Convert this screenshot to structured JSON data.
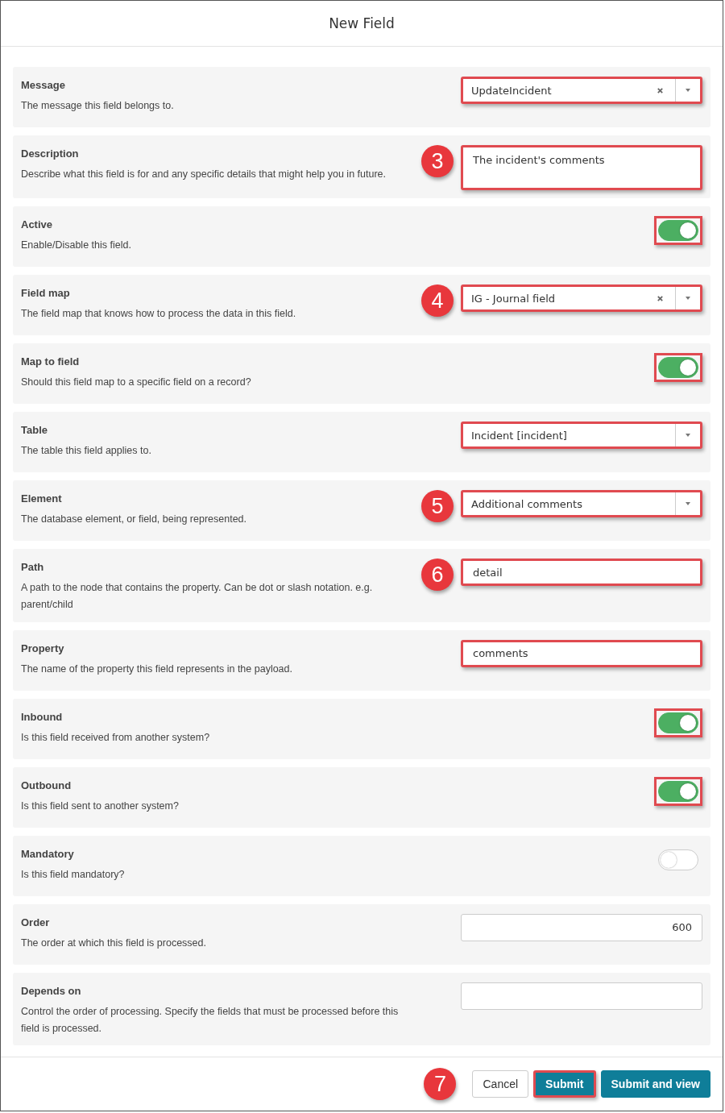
{
  "dialog": {
    "title": "New Field"
  },
  "rows": [
    {
      "label": "Message",
      "help": "The message this field belongs to.",
      "kind": "select",
      "value": "UpdateIncident",
      "clearable": true,
      "highlighted": true
    },
    {
      "label": "Description",
      "help": "Describe what this field is for and any specific details that might help you in future.",
      "kind": "textarea",
      "value": "The incident's comments",
      "highlighted": true,
      "callout": "3"
    },
    {
      "label": "Active",
      "help": "Enable/Disable this field.",
      "kind": "toggle",
      "on": true,
      "highlighted": true
    },
    {
      "label": "Field map",
      "help": "The field map that knows how to process the data in this field.",
      "kind": "select",
      "value": "IG - Journal field",
      "clearable": true,
      "highlighted": true,
      "callout": "4"
    },
    {
      "label": "Map to field",
      "help": "Should this field map to a specific field on a record?",
      "kind": "toggle",
      "on": true,
      "highlighted": true
    },
    {
      "label": "Table",
      "help": "The table this field applies to.",
      "kind": "select",
      "value": "Incident [incident]",
      "clearable": false,
      "highlighted": true
    },
    {
      "label": "Element",
      "help": "The database element, or field, being represented.",
      "kind": "select",
      "value": "Additional comments",
      "clearable": false,
      "highlighted": true,
      "callout": "5"
    },
    {
      "label": "Path",
      "help": "A path to the node that contains the property. Can be dot or slash notation. e.g. parent/child",
      "kind": "text",
      "value": "detail",
      "highlighted": true,
      "callout": "6"
    },
    {
      "label": "Property",
      "help": "The name of the property this field represents in the payload.",
      "kind": "text",
      "value": "comments",
      "highlighted": true
    },
    {
      "label": "Inbound",
      "help": "Is this field received from another system?",
      "kind": "toggle",
      "on": true,
      "highlighted": true
    },
    {
      "label": "Outbound",
      "help": "Is this field sent to another system?",
      "kind": "toggle",
      "on": true,
      "highlighted": true
    },
    {
      "label": "Mandatory",
      "help": "Is this field mandatory?",
      "kind": "toggle",
      "on": false,
      "highlighted": false
    },
    {
      "label": "Order",
      "help": "The order at which this field is processed.",
      "kind": "number",
      "value": "600",
      "highlighted": false
    },
    {
      "label": "Depends on",
      "help": "Control the order of processing. Specify the fields that must be processed before this field is processed.",
      "kind": "text",
      "highlighted": false
    }
  ],
  "footer": {
    "callout": "7",
    "buttons": [
      {
        "label": "Cancel",
        "kind": "secondary",
        "highlighted": false
      },
      {
        "label": "Submit",
        "kind": "primary",
        "highlighted": true
      },
      {
        "label": "Submit and view",
        "kind": "primary",
        "highlighted": false
      }
    ]
  }
}
